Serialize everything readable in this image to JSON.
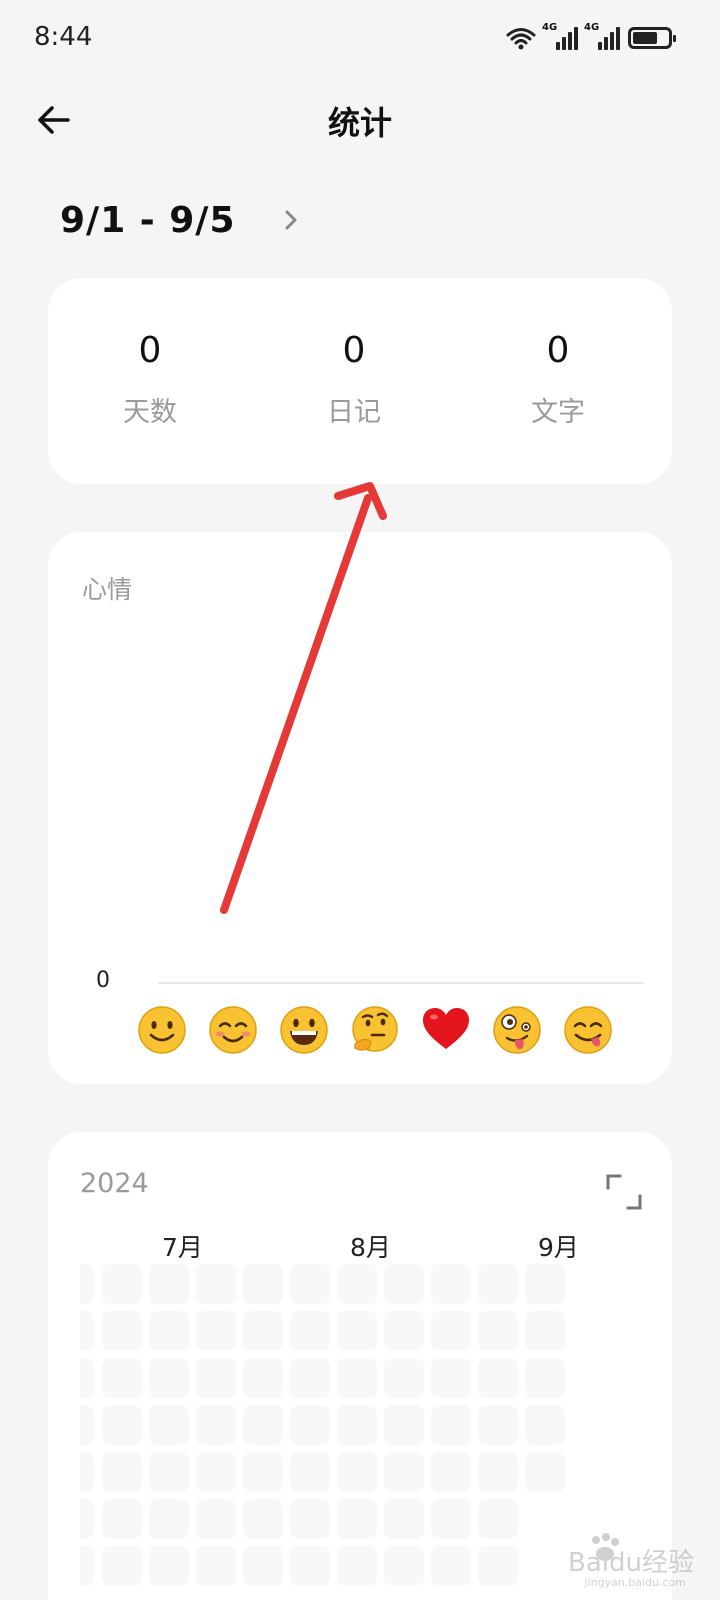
{
  "status_bar": {
    "time": "8:44",
    "network_1": "4G",
    "network_2": "4G"
  },
  "header": {
    "title": "统计"
  },
  "date_range": {
    "label": "9/1 - 9/5"
  },
  "summary": [
    {
      "value": "0",
      "label": "天数"
    },
    {
      "value": "0",
      "label": "日记"
    },
    {
      "value": "0",
      "label": "文字"
    }
  ],
  "mood": {
    "title": "心情",
    "axis_value": "0",
    "emojis": [
      "smile-emoji",
      "blush-emoji",
      "grin-emoji",
      "thinking-emoji",
      "heart-emoji",
      "zany-emoji",
      "yum-emoji"
    ]
  },
  "year": {
    "label": "2024",
    "months": [
      "7月",
      "8月",
      "9月"
    ]
  },
  "watermark": {
    "text": "Baidu经验",
    "sub": "jingyan.baidu.com"
  },
  "colors": {
    "background": "#f5f5f5",
    "card": "#ffffff",
    "annotation_arrow": "#e53935",
    "cell": "#f6f8fa"
  }
}
